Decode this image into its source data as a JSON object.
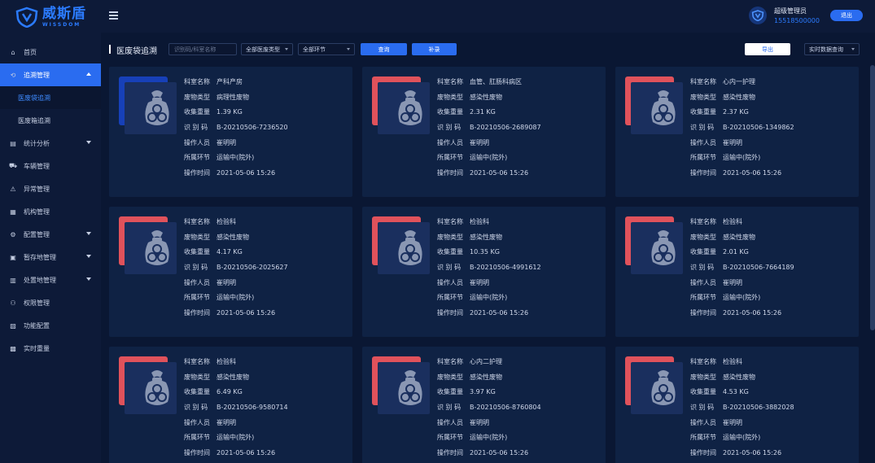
{
  "brand": {
    "name_cn": "威斯盾",
    "name_en": "WISSDOM"
  },
  "sidebar": {
    "items": [
      {
        "label": "首页",
        "icon": "home-icon",
        "caret": false
      },
      {
        "label": "追溯管理",
        "icon": "trace-icon",
        "caret": true,
        "active": true,
        "children": [
          {
            "label": "医废袋追溯",
            "current": true
          },
          {
            "label": "医废箱追溯",
            "current": false
          }
        ]
      },
      {
        "label": "统计分析",
        "icon": "chart-icon",
        "caret": true
      },
      {
        "label": "车辆管理",
        "icon": "car-icon",
        "caret": false
      },
      {
        "label": "异常管理",
        "icon": "warning-icon",
        "caret": false
      },
      {
        "label": "机构管理",
        "icon": "building-icon",
        "caret": false
      },
      {
        "label": "配置管理",
        "icon": "gear-icon",
        "caret": true
      },
      {
        "label": "暂存地管理",
        "icon": "storage-icon",
        "caret": true
      },
      {
        "label": "处置地管理",
        "icon": "disposal-icon",
        "caret": true
      },
      {
        "label": "权限管理",
        "icon": "user-icon",
        "caret": false
      },
      {
        "label": "功能配置",
        "icon": "function-icon",
        "caret": false
      },
      {
        "label": "实时重量",
        "icon": "scale-icon",
        "caret": false
      }
    ]
  },
  "header": {
    "user_name": "超级管理员",
    "user_phone": "15518500000",
    "logout_label": "退出"
  },
  "toolbar": {
    "title": "医废袋追溯",
    "search_placeholder": "识别码/科室名称",
    "type_select": "全部医废类型",
    "stage_select": "全部环节",
    "query_label": "查询",
    "reset_label": "补录",
    "export_label": "导出",
    "realtime_select": "实时数据查询"
  },
  "labels": {
    "dept": "科室名称",
    "type": "废物类型",
    "weight": "收集重量",
    "code": "识 别 码",
    "operator": "操作人员",
    "stage": "所属环节",
    "time": "操作时间"
  },
  "colors": {
    "accent": "#2a6cf0",
    "bag_blue": "#1740b8",
    "bag_red": "#e0525b"
  },
  "cards": [
    {
      "color": "blue",
      "dept": "产科产房",
      "type": "病理性废物",
      "weight": "1.39 KG",
      "code": "B-20210506-7236520",
      "operator": "崔明明",
      "stage": "运输中(院外)",
      "time": "2021-05-06 15:26"
    },
    {
      "color": "red",
      "dept": "血管、肛肠科病区",
      "type": "感染性废物",
      "weight": "2.31 KG",
      "code": "B-20210506-2689087",
      "operator": "崔明明",
      "stage": "运输中(院外)",
      "time": "2021-05-06 15:26"
    },
    {
      "color": "red",
      "dept": "心内一护理",
      "type": "感染性废物",
      "weight": "2.37 KG",
      "code": "B-20210506-1349862",
      "operator": "崔明明",
      "stage": "运输中(院外)",
      "time": "2021-05-06 15:26"
    },
    {
      "color": "red",
      "dept": "检验科",
      "type": "感染性废物",
      "weight": "4.17 KG",
      "code": "B-20210506-2025627",
      "operator": "崔明明",
      "stage": "运输中(院外)",
      "time": "2021-05-06 15:26"
    },
    {
      "color": "red",
      "dept": "检验科",
      "type": "感染性废物",
      "weight": "10.35 KG",
      "code": "B-20210506-4991612",
      "operator": "崔明明",
      "stage": "运输中(院外)",
      "time": "2021-05-06 15:26"
    },
    {
      "color": "red",
      "dept": "检验科",
      "type": "感染性废物",
      "weight": "2.01 KG",
      "code": "B-20210506-7664189",
      "operator": "崔明明",
      "stage": "运输中(院外)",
      "time": "2021-05-06 15:26"
    },
    {
      "color": "red",
      "dept": "检验科",
      "type": "感染性废物",
      "weight": "6.49 KG",
      "code": "B-20210506-9580714",
      "operator": "崔明明",
      "stage": "运输中(院外)",
      "time": "2021-05-06 15:26"
    },
    {
      "color": "red",
      "dept": "心内二护理",
      "type": "感染性废物",
      "weight": "3.97 KG",
      "code": "B-20210506-8760804",
      "operator": "崔明明",
      "stage": "运输中(院外)",
      "time": "2021-05-06 15:26"
    },
    {
      "color": "red",
      "dept": "检验科",
      "type": "感染性废物",
      "weight": "4.53 KG",
      "code": "B-20210506-3882028",
      "operator": "崔明明",
      "stage": "运输中(院外)",
      "time": "2021-05-06 15:26"
    }
  ]
}
